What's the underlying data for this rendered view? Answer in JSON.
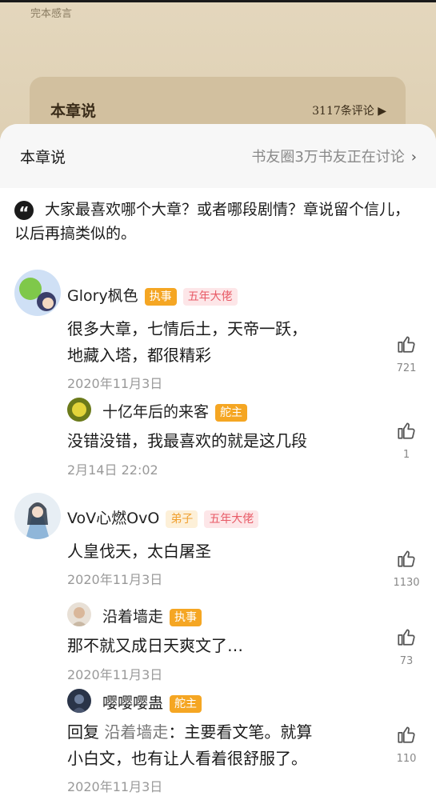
{
  "background": {
    "caption": "完本感言",
    "card_title": "本章说",
    "card_count": "3117条评论 ▶"
  },
  "header": {
    "title": "本章说",
    "link_text": "书友圈3万书友正在讨论",
    "chevron": "›"
  },
  "prompt": {
    "icon": "quote-icon",
    "text": "大家最喜欢哪个大章？或者哪段剧情？章说留个信儿，以后再搞类似的。"
  },
  "comments": [
    {
      "user": "Glory枫色",
      "badges": [
        "执事",
        "五年大佬"
      ],
      "text_line1": "很多大章，七情后土，天帝一跃，",
      "text_line2": "地藏入塔，都很精彩",
      "date": "2020年11月3日",
      "likes": "721"
    },
    {
      "user": "十亿年后的来客",
      "badges": [
        "舵主"
      ],
      "text_line1": "没错没错，我最喜欢的就是这几段",
      "date": "2月14日 22:02",
      "likes": "1"
    },
    {
      "user": "VoV心燃OvO",
      "badges": [
        "弟子",
        "五年大佬"
      ],
      "text_line1": "人皇伐天，太白屠圣",
      "date": "2020年11月3日",
      "likes": "1130"
    },
    {
      "user": "沿着墙走",
      "badges": [
        "执事"
      ],
      "text_line1": "那不就又成日天爽文了…",
      "date": "2020年11月3日",
      "likes": "73"
    },
    {
      "user": "嘤嘤嘤蛊",
      "badges": [
        "舵主"
      ],
      "reply_prefix": "回复 ",
      "reply_to": "沿着墙走",
      "text_line1": "：主要看文笔。就算",
      "text_line2": "小白文，也有让人看着很舒服了。",
      "date": "2020年11月3日",
      "likes": "110"
    }
  ],
  "colors": {
    "paper": "#dccdb0",
    "badge_orange": "#f5a623",
    "badge_pink_text": "#e85a66"
  }
}
